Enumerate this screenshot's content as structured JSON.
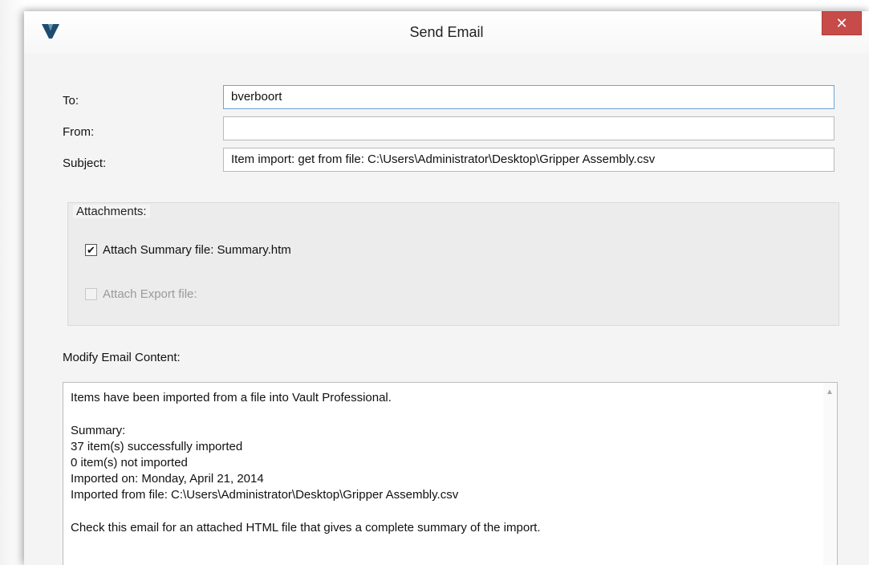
{
  "window": {
    "title": "Send Email",
    "close_label": "✕"
  },
  "form": {
    "to_label": "To:",
    "to_value": "bverboort",
    "from_label": "From:",
    "from_value": "",
    "subject_label": "Subject:",
    "subject_value": "Item import: get from file: C:\\Users\\Administrator\\Desktop\\Gripper Assembly.csv"
  },
  "attachments": {
    "title": "Attachments:",
    "summary_label": "Attach Summary file: Summary.htm",
    "summary_checked": true,
    "summary_check_glyph": "✔",
    "export_label": "Attach Export file:",
    "export_checked": false
  },
  "content": {
    "title": "Modify Email Content:",
    "lines": [
      "Items have been imported from a file into Vault Professional.",
      "",
      "Summary:",
      "37 item(s) successfully imported",
      "0 item(s) not imported",
      "Imported on: Monday, April 21, 2014",
      "Imported from file: C:\\Users\\Administrator\\Desktop\\Gripper Assembly.csv",
      "",
      "Check this email for an attached HTML file that gives a complete summary of the import."
    ]
  },
  "colors": {
    "accent": "#6aa3d6",
    "close": "#c74b48"
  },
  "icons": {
    "app": "vault-logo-icon",
    "close": "close-icon",
    "scroll": "scroll-up-arrow-icon"
  }
}
